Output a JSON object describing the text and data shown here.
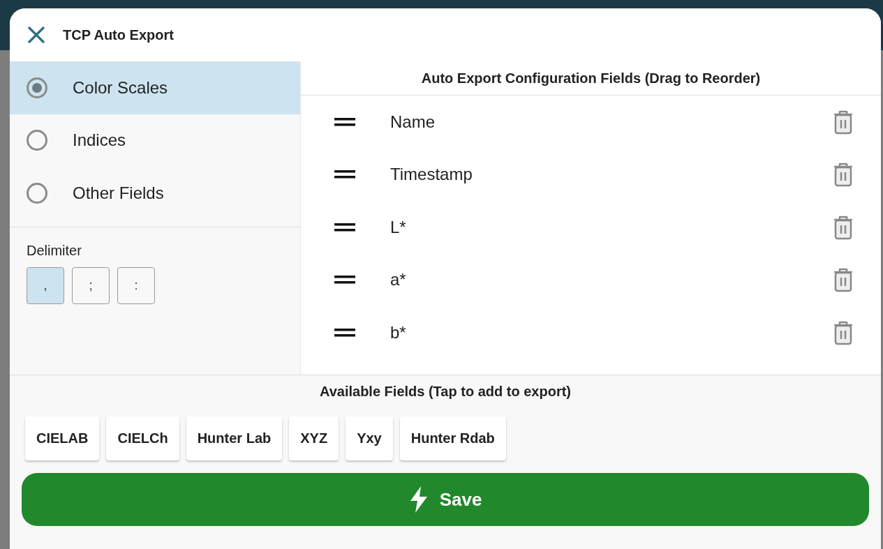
{
  "dialog": {
    "title": "TCP Auto Export"
  },
  "categories": [
    {
      "label": "Color Scales",
      "selected": true
    },
    {
      "label": "Indices",
      "selected": false
    },
    {
      "label": "Other Fields",
      "selected": false
    }
  ],
  "delimiter": {
    "label": "Delimiter",
    "options": [
      {
        "label": ",",
        "selected": true
      },
      {
        "label": ";",
        "selected": false
      },
      {
        "label": ":",
        "selected": false
      }
    ]
  },
  "export_fields": {
    "title": "Auto Export Configuration Fields (Drag to Reorder)",
    "items": [
      {
        "label": "Name"
      },
      {
        "label": "Timestamp"
      },
      {
        "label": "L*"
      },
      {
        "label": "a*"
      },
      {
        "label": "b*"
      }
    ]
  },
  "available_fields": {
    "title": "Available Fields (Tap to add to export)",
    "items": [
      "CIELAB",
      "CIELCh",
      "Hunter Lab",
      "XYZ",
      "Yxy",
      "Hunter Rdab"
    ]
  },
  "save_button": {
    "label": "Save"
  }
}
